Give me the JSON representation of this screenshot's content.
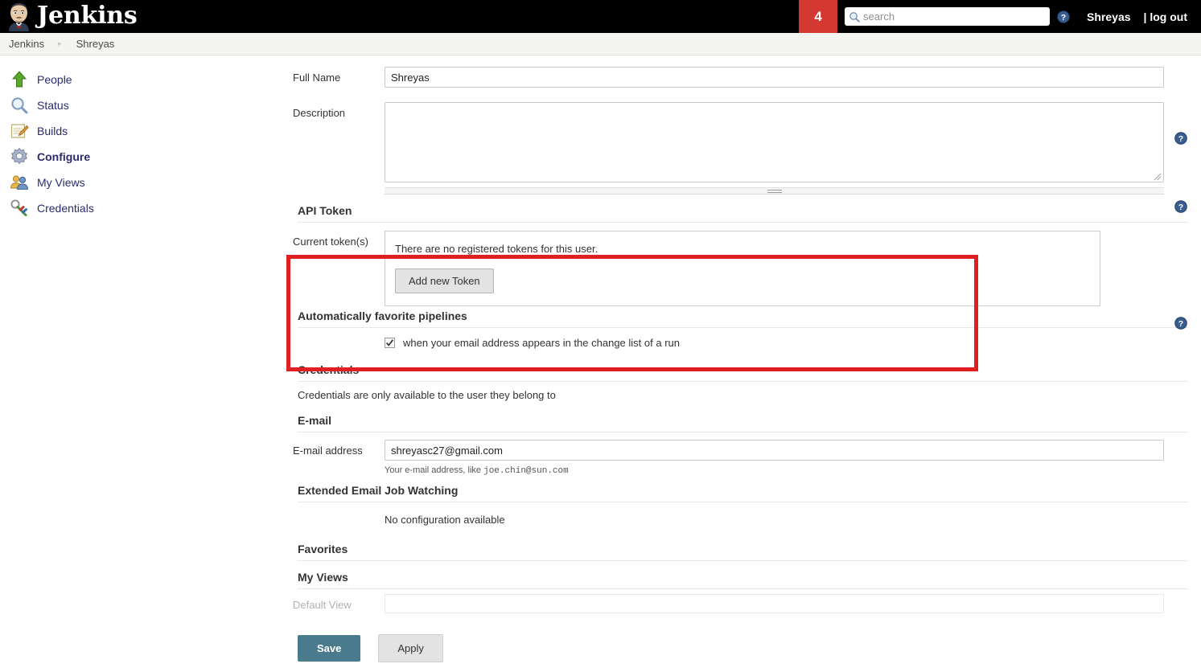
{
  "header": {
    "brand": "Jenkins",
    "logo_icon": "jenkins-butler-icon",
    "badge_count": "4",
    "search_placeholder": "search",
    "search_value": "",
    "search_icon": "magnifier-icon",
    "help_icon": "help-circle-icon",
    "user": "Shreyas",
    "logout": "| log out",
    "badge_color": "#d33833",
    "bar_color": "#000000"
  },
  "breadcrumb": {
    "items": [
      {
        "label": "Jenkins"
      },
      {
        "label": "Shreyas"
      }
    ],
    "separator": "▸"
  },
  "sidebar": {
    "items": [
      {
        "label": "People",
        "icon": "person-up-arrow-icon",
        "active": false
      },
      {
        "label": "Status",
        "icon": "magnifier-icon",
        "active": false
      },
      {
        "label": "Builds",
        "icon": "notepad-pencil-icon",
        "active": false
      },
      {
        "label": "Configure",
        "icon": "gear-icon",
        "active": true
      },
      {
        "label": "My Views",
        "icon": "people-icon",
        "active": false
      },
      {
        "label": "Credentials",
        "icon": "key-icon",
        "active": false
      }
    ]
  },
  "form": {
    "full_name": {
      "label": "Full Name",
      "value": "Shreyas"
    },
    "description": {
      "label": "Description",
      "value": "",
      "placeholder": ""
    },
    "api_token": {
      "section_title": "API Token",
      "row_label": "Current token(s)",
      "empty_message": "There are no registered tokens for this user.",
      "add_button": "Add new Token",
      "highlight_color": "#e02020"
    },
    "auto_favorite": {
      "section_title": "Automatically favorite pipelines",
      "checkbox_label": "when your email address appears in the change list of a run",
      "checked": true
    },
    "credentials": {
      "section_title": "Credentials",
      "note": "Credentials are only available to the user they belong to"
    },
    "email": {
      "section_title": "E-mail",
      "row_label": "E-mail address",
      "value": "shreyasc27@gmail.com",
      "hint_prefix": "Your e-mail address, like ",
      "hint_example": "joe.chin@sun.com"
    },
    "extended_email": {
      "section_title": "Extended Email Job Watching",
      "message": "No configuration available"
    },
    "favorites": {
      "section_title": "Favorites"
    },
    "my_views": {
      "section_title": "My Views",
      "row_label": "Default View",
      "value": ""
    }
  },
  "buttons": {
    "save": "Save",
    "apply": "Apply",
    "save_color": "#4a7b8c"
  }
}
